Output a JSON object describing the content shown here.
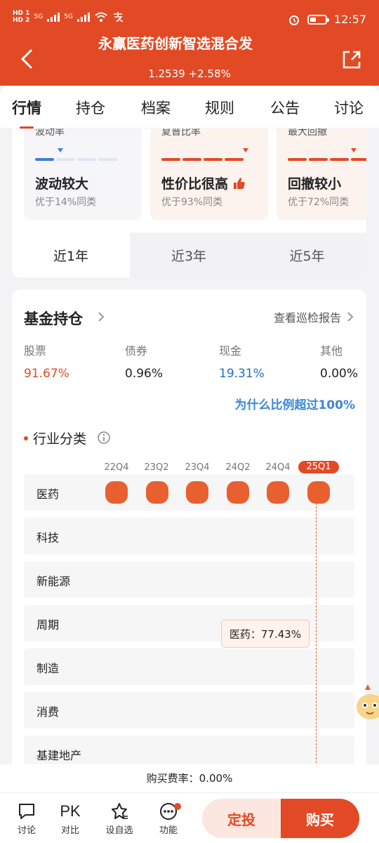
{
  "status_bar": {
    "hd1": "HD 1",
    "hd2": "HD 2",
    "net1": "5G",
    "net2": "5G",
    "time": "12:57"
  },
  "header": {
    "title": "永赢医药创新智选混合发",
    "nav_value": "1.2539",
    "change": "+2.58%"
  },
  "tabs": [
    "行情",
    "持仓",
    "档案",
    "规则",
    "公告",
    "讨论"
  ],
  "risk_metrics": [
    {
      "label": "波动率",
      "title": "波动较大",
      "desc": "优于14%同类",
      "level": 0.14,
      "color": "#3f7fd8"
    },
    {
      "label": "夏普比率",
      "title": "性价比很高",
      "desc": "优于93%同类",
      "level": 0.93,
      "color": "#e24a25"
    },
    {
      "label": "最大回撤",
      "title": "回撤较小",
      "desc": "优于72%同类",
      "level": 0.72,
      "color": "#e24a25"
    }
  ],
  "period_tabs": [
    "近1年",
    "近3年",
    "近5年"
  ],
  "holdings": {
    "title": "基金持仓",
    "report_link": "查看巡检报告",
    "assets": [
      {
        "label": "股票",
        "value": "91.67%"
      },
      {
        "label": "债券",
        "value": "0.96%"
      },
      {
        "label": "现金",
        "value": "19.31%"
      },
      {
        "label": "其他",
        "value": "0.00%"
      }
    ],
    "why_link": "为什么比例超过100%",
    "industry_title": "行业分类",
    "quarters": [
      "22Q4",
      "23Q2",
      "23Q4",
      "24Q2",
      "24Q4",
      "25Q1"
    ],
    "industries": [
      "医药",
      "科技",
      "新能源",
      "周期",
      "制造",
      "消费",
      "基建地产"
    ],
    "tooltip": "医药：77.43%"
  },
  "fee": "购买费率：0.00%",
  "bottom_bar": {
    "items": [
      "讨论",
      "对比",
      "设自选",
      "功能"
    ],
    "pk_label": "PK",
    "fixed_invest": "定投",
    "buy": "购买"
  }
}
